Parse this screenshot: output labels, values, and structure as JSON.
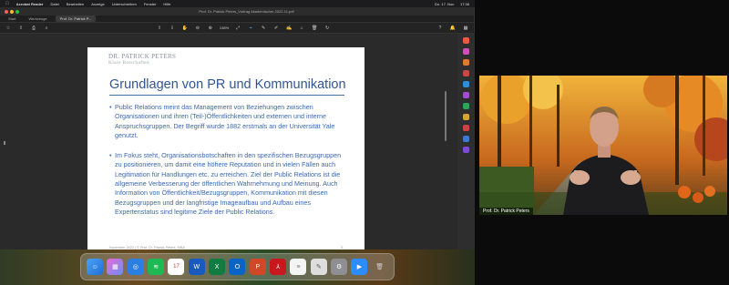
{
  "menubar": {
    "items": [
      "Acrobat Reader",
      "Datei",
      "Bearbeiten",
      "Anzeige",
      "Unterschreiben",
      "Fenster",
      "Hilfe"
    ],
    "right_items": [
      "Do. 17. Nov.",
      "17:38"
    ]
  },
  "window": {
    "title": "Prof. Dr. Patrick Peters_Vortrag Akademischer 2022-11.pdf"
  },
  "tabs": [
    {
      "label": "Start"
    },
    {
      "label": "Werkzeuge"
    },
    {
      "label": "Prof. Dr. Patrick P..."
    }
  ],
  "toolbar": {
    "zoom": "138%"
  },
  "slide": {
    "brand_name": "DR. PATRICK PETERS",
    "brand_sub": "Klare Botschaften",
    "title": "Grundlagen von PR und Kommunikation",
    "bullets": [
      "Public Relations meint das Management von Beziehungen zwischen Organisationen und ihren (Teil-)Öffentlichkeiten und externen und interne Anspruchsgruppen. Der Begriff wurde 1882 erstmals an der Universität Yale genutzt.",
      "Im Fokus steht, Organisationsbotschaften in den spezifischen Bezugsgruppen zu positionieren, um damit eine höhere Reputation und in vielen Fällen auch Legitimation für Handlungen etc. zu erreichen. Ziel der Public Relations ist die allgemeine Verbesserung der öffentlichen Wahrnehmung und Meinung. Auch Information von Öffentlichkeit/Bezugsgruppen, Kommunikation mit diesen Bezugsgruppen und der langfristige Imageaufbau und Aufbau eines Expertenstatus sind legitime Ziele der Public Relations."
    ],
    "footer": "November 2022 | © Prof. Dr. Patrick Peters, MBA",
    "page_number": "3"
  },
  "dock": {
    "calendar_day": "17"
  },
  "video": {
    "participant_name": "Prof. Dr. Patrick Peters"
  },
  "colors": {
    "slide_blue": "#2f5597",
    "accent": "#4a8df6"
  }
}
